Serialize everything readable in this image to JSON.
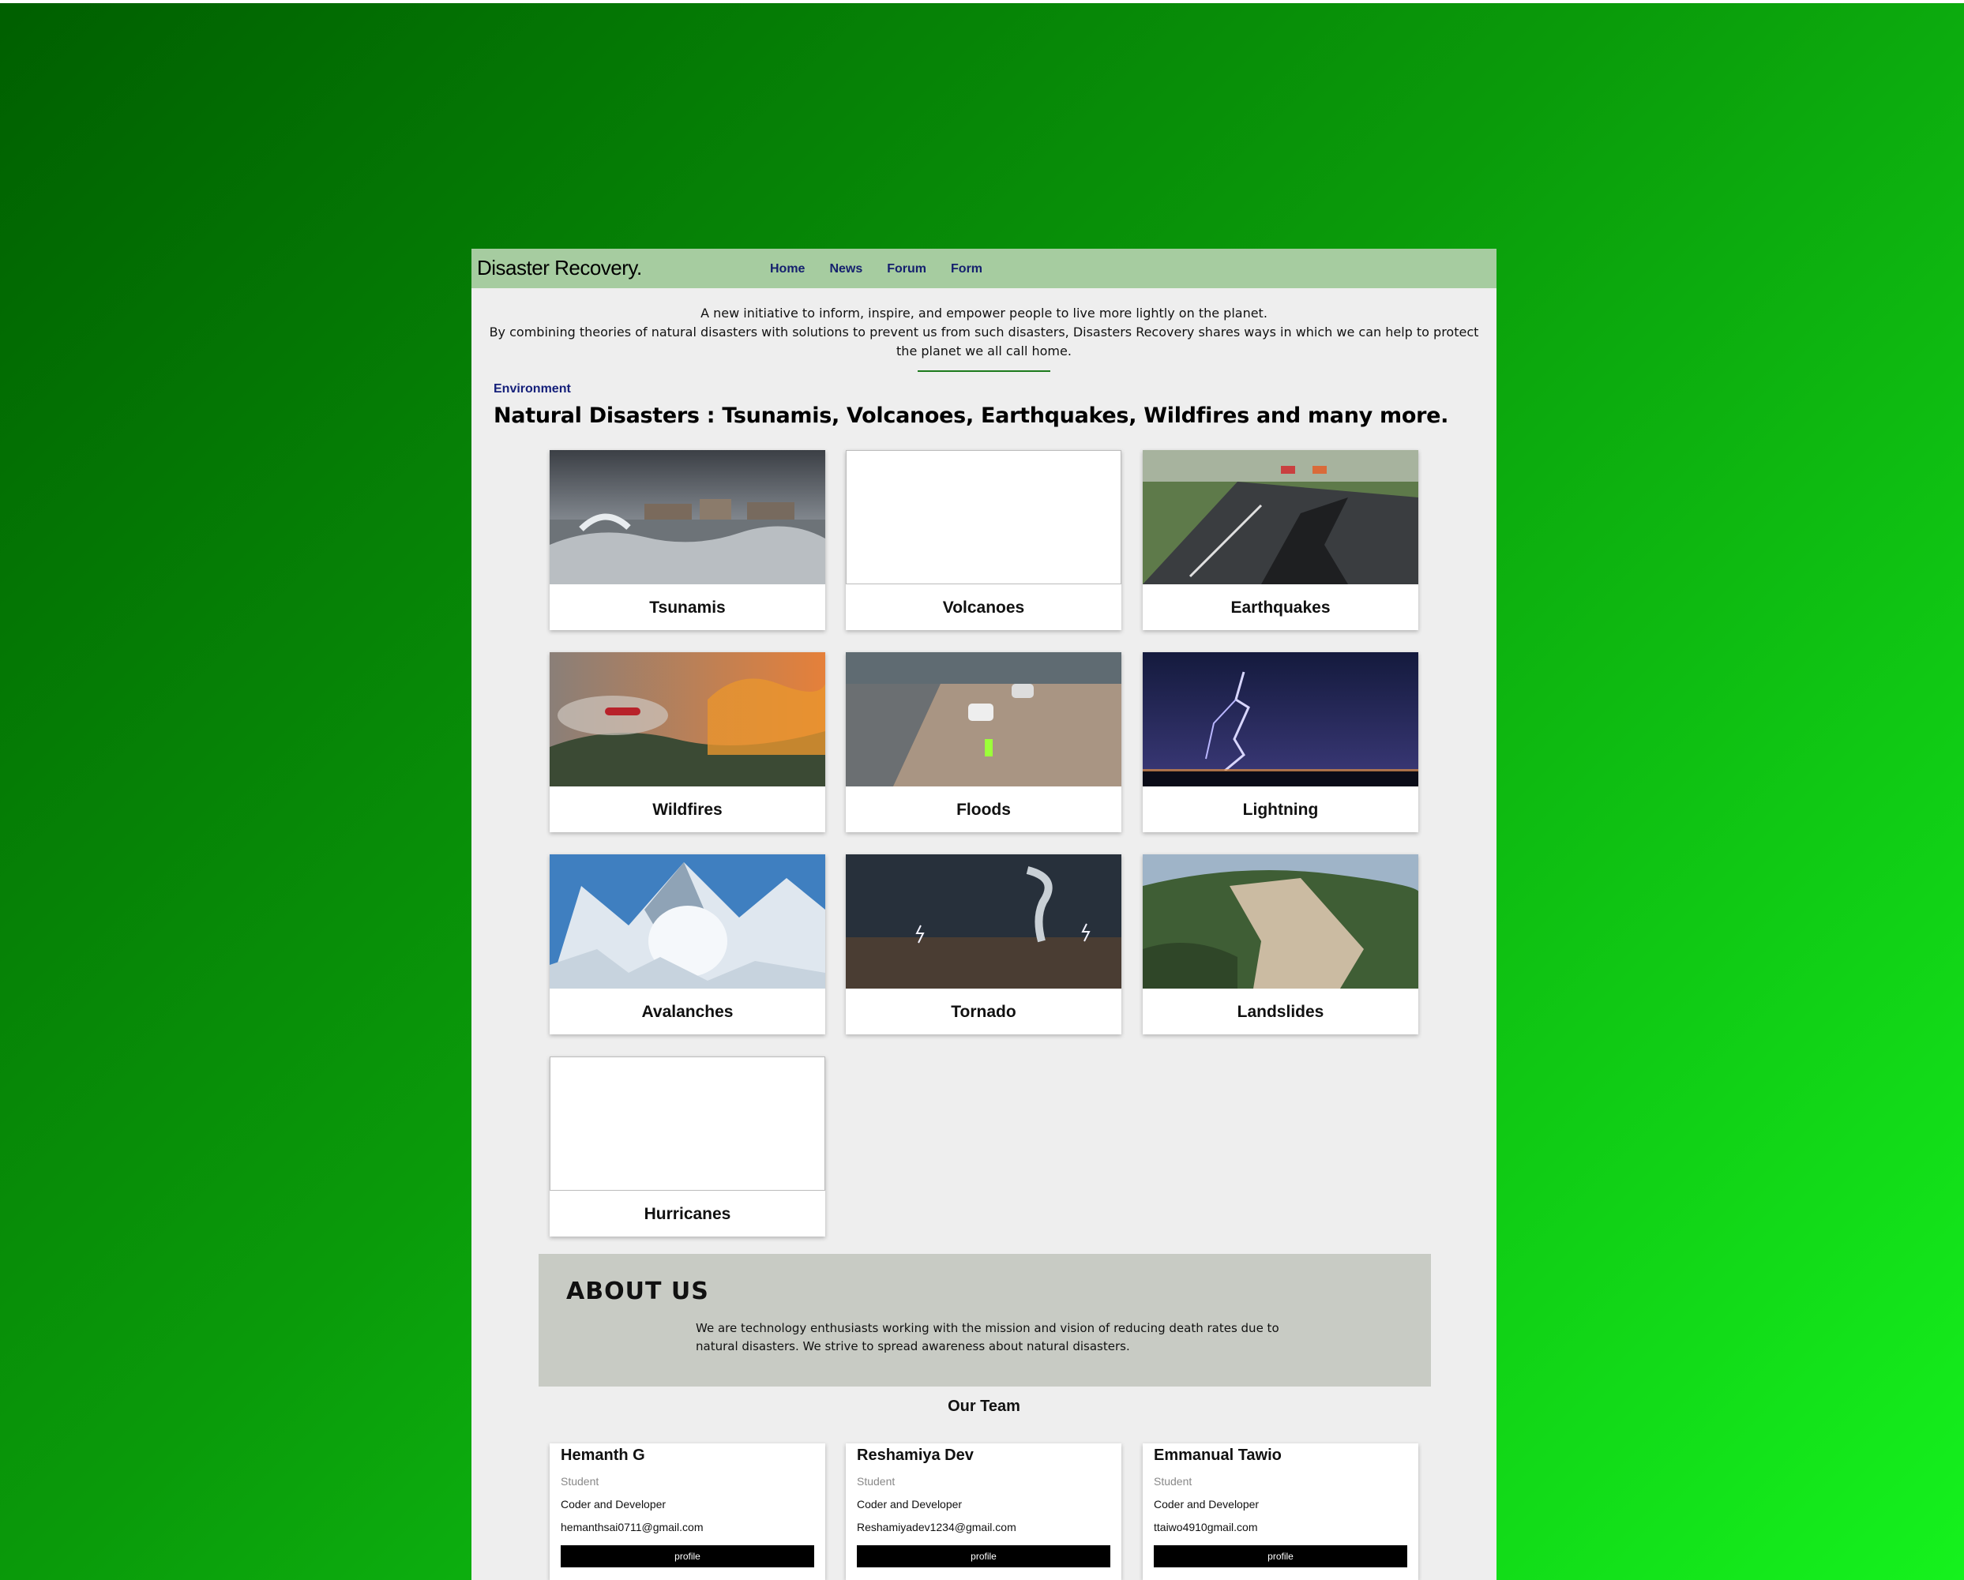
{
  "brand": {
    "bold": "Disaster",
    "light": "Recovery."
  },
  "nav": {
    "items": [
      "Home",
      "News",
      "Forum",
      "Form"
    ]
  },
  "intro": {
    "line1": "A new initiative to inform, inspire, and empower people to live more lightly on the planet.",
    "line2": "By combining theories of natural disasters with solutions to prevent us from such disasters, Disasters Recovery shares ways in which we can help to protect the planet we all call home."
  },
  "category": "Environment",
  "headline": "Natural Disasters : Tsunamis, Volcanoes, Earthquakes, Wildfires and many more.",
  "disasters": [
    {
      "label": "Tsunamis",
      "image": "tsunami-image"
    },
    {
      "label": "Volcanoes",
      "image": "blank"
    },
    {
      "label": "Earthquakes",
      "image": "earthquake-image"
    },
    {
      "label": "Wildfires",
      "image": "wildfire-image"
    },
    {
      "label": "Floods",
      "image": "flood-image"
    },
    {
      "label": "Lightning",
      "image": "lightning-image"
    },
    {
      "label": "Avalanches",
      "image": "avalanche-image"
    },
    {
      "label": "Tornado",
      "image": "tornado-image"
    },
    {
      "label": "Landslides",
      "image": "landslide-image"
    },
    {
      "label": "Hurricanes",
      "image": "blank"
    }
  ],
  "about": {
    "title": "ABOUT US",
    "text": "We are technology enthusiasts working with the mission and vision of reducing death rates due to natural disasters. We strive to spread awareness about natural disasters."
  },
  "team": {
    "title": "Our Team",
    "members": [
      {
        "name": "Hemanth G",
        "role": "Student",
        "desc": "Coder and Developer",
        "email": "hemanthsai0711@gmail.com",
        "button": "profile"
      },
      {
        "name": "Reshamiya Dev",
        "role": "Student",
        "desc": "Coder and Developer",
        "email": "Reshamiyadev1234@gmail.com",
        "button": "profile"
      },
      {
        "name": "Emmanual Tawio",
        "role": "Student",
        "desc": "Coder and Developer",
        "email": "ttaiwo4910gmail.com",
        "button": "profile"
      }
    ]
  },
  "colors": {
    "navbar": "#a6cca0",
    "nav_link": "#15206e",
    "about_bg": "#c8cbc4",
    "page_bg": "#eeeeee"
  }
}
